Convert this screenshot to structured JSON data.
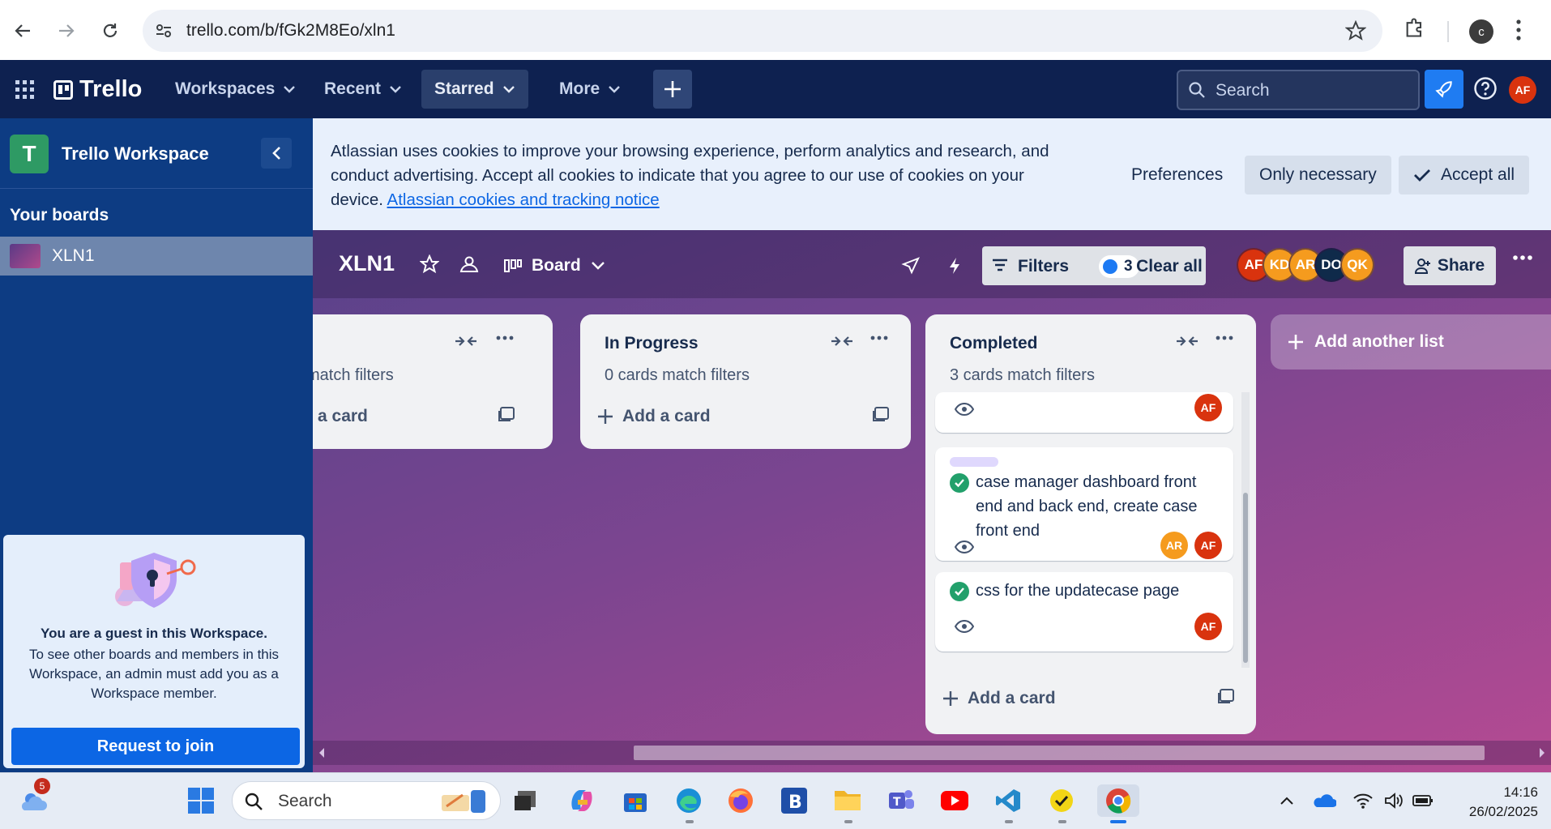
{
  "browser": {
    "url": "trello.com/b/fGk2M8Eo/xln1",
    "profile_initial": "c"
  },
  "header": {
    "logo": "Trello",
    "menus": [
      "Workspaces",
      "Recent",
      "Starred",
      "More"
    ],
    "search_placeholder": "Search",
    "user_initials": "AF"
  },
  "sidebar": {
    "workspace_initial": "T",
    "workspace_name": "Trello Workspace",
    "your_boards": "Your boards",
    "boards": [
      "XLN1"
    ],
    "guest_title": "You are a guest in this Workspace.",
    "guest_text": "To see other boards and members in this Workspace, an admin must add you as a Workspace member.",
    "join_button": "Request to join"
  },
  "cookie_banner": {
    "message": "Atlassian uses cookies to improve your browsing experience, perform analytics and research, and conduct advertising. Accept all cookies to indicate that you agree to our use of cookies on your device.",
    "link": "Atlassian cookies and tracking notice",
    "preferences": "Preferences",
    "only_necessary": "Only necessary",
    "accept_all": "Accept all"
  },
  "board": {
    "name": "XLN1",
    "view": "Board",
    "filters_label": "Filters",
    "filter_count": "3",
    "clear_all": "Clear all",
    "members": [
      {
        "initials": "AF",
        "color": "#d9330e"
      },
      {
        "initials": "KD",
        "color": "#f59b1e"
      },
      {
        "initials": "AR",
        "color": "#f59b1e"
      },
      {
        "initials": "DO",
        "color": "#0f2a4a"
      },
      {
        "initials": "QK",
        "color": "#f59b1e"
      }
    ],
    "share": "Share",
    "add_list": "Add another list"
  },
  "lists": [
    {
      "title": "",
      "match": "match filters",
      "add_card": "a card"
    },
    {
      "title": "In Progress",
      "match": "0 cards match filters",
      "add_card": "Add a card"
    },
    {
      "title": "Completed",
      "match": "3 cards match filters",
      "add_card": "Add a card",
      "cards": [
        {
          "title": "",
          "members": [
            "AF"
          ]
        },
        {
          "title": "case manager dashboard front end and back end, create case front end",
          "members": [
            "AR",
            "AF"
          ]
        },
        {
          "title": "css for the updatecase page",
          "members": [
            "AF"
          ]
        }
      ]
    }
  ],
  "colors": {
    "header_bg": "#0e2150",
    "sidebar_bg": "#0d3c83",
    "accent_blue": "#0c66e4",
    "check_green": "#22a06b"
  },
  "taskbar": {
    "search": "Search",
    "notification_count": "5",
    "time": "14:16",
    "date": "26/02/2025"
  }
}
